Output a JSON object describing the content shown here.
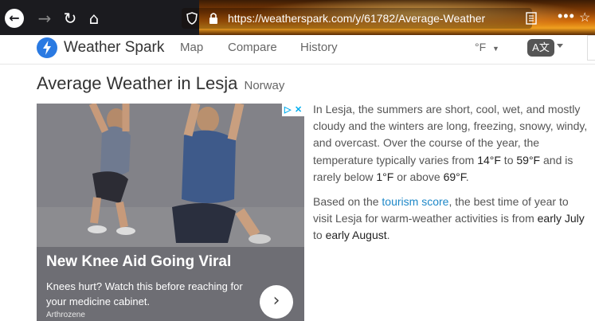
{
  "browser": {
    "url": "https://weatherspark.com/y/61782/Average-Weather"
  },
  "header": {
    "brand": "Weather Spark",
    "nav": [
      "Map",
      "Compare",
      "History"
    ],
    "unit": "°F",
    "lang_icon_text": "A文"
  },
  "page": {
    "title": "Average Weather in Lesja",
    "country": "Norway"
  },
  "ad": {
    "headline": "New Knee Aid Going Viral",
    "body": "Knees hurt? Watch this before reaching for your medicine cabinet.",
    "source": "Arthrozene",
    "arrow": "›"
  },
  "summary": {
    "p1_a": "In Lesja, the summers are short, cool, wet, and mostly cloudy and the winters are long, freezing, snowy, windy, and overcast. Over the course of the year, the temperature typically varies from ",
    "temp_low": "14°F",
    "p1_b": " to ",
    "temp_high": "59°F",
    "p1_c": " and is rarely below ",
    "temp_min": "1°F",
    "p1_d": " or above ",
    "temp_max": "69°F",
    "p1_e": ".",
    "p2_a": "Based on the ",
    "tourism_link": "tourism score",
    "p2_b": ", the best time of year to visit Lesja for warm-weather activities is from ",
    "best_start": "early July",
    "p2_c": " to ",
    "best_end": "early August",
    "p2_d": "."
  },
  "colors": {
    "link": "#1e88c8",
    "logo": "#2a7ae2"
  }
}
